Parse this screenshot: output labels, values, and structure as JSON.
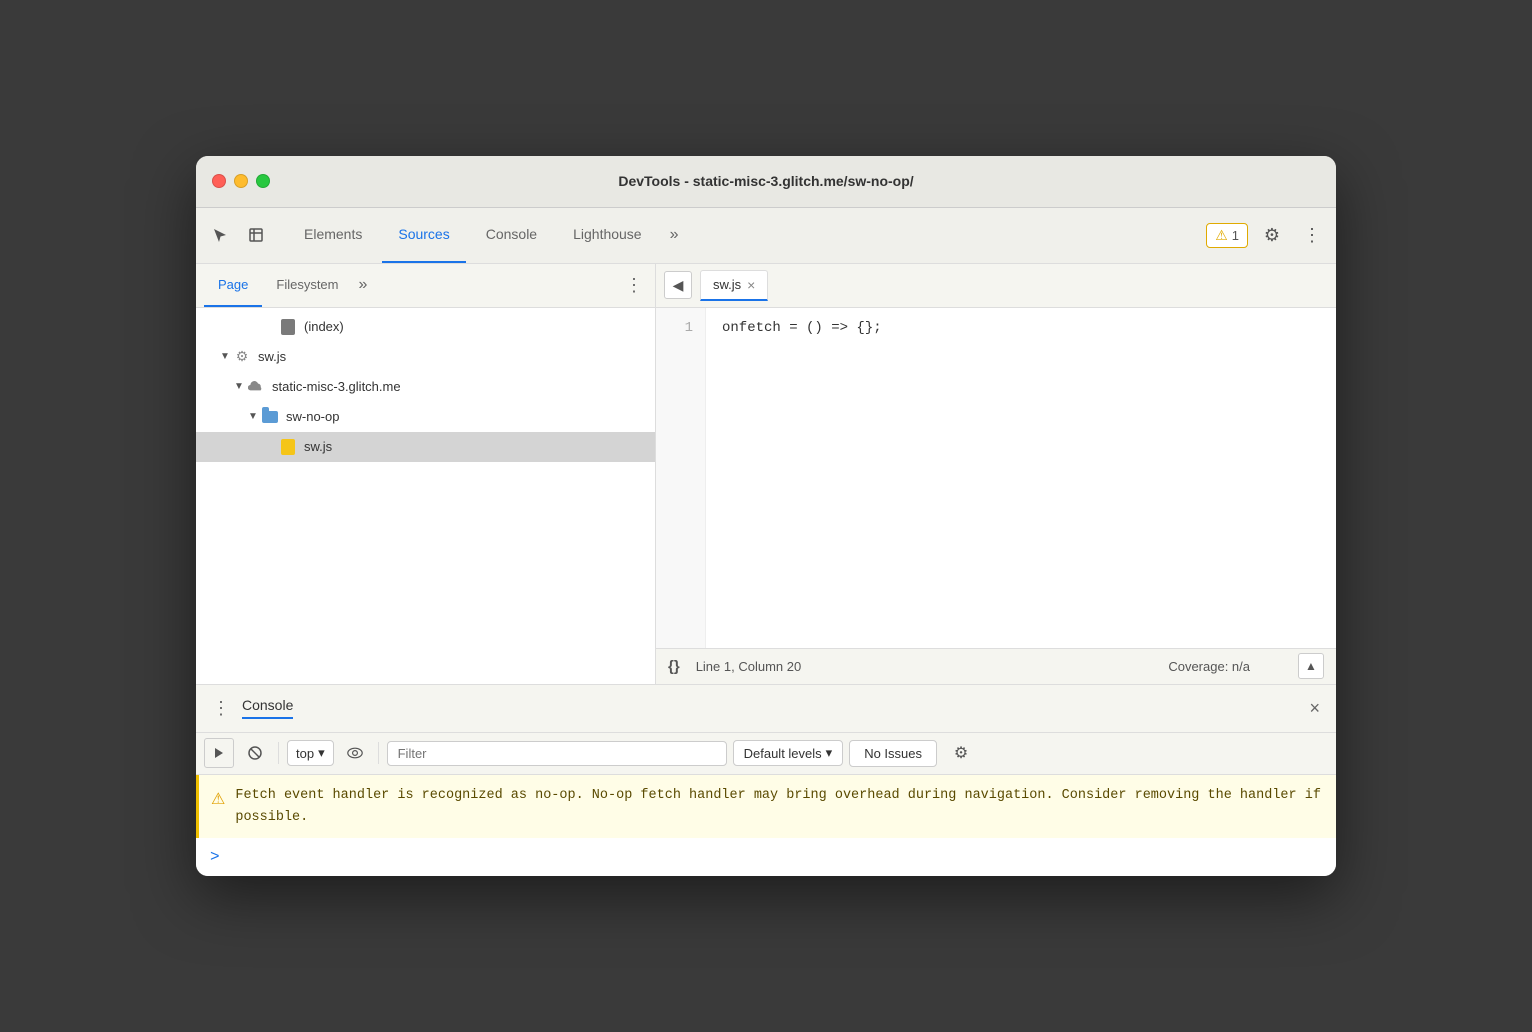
{
  "window": {
    "title": "DevTools - static-misc-3.glitch.me/sw-no-op/"
  },
  "tabbar": {
    "tabs": [
      {
        "label": "Elements",
        "active": false
      },
      {
        "label": "Sources",
        "active": true
      },
      {
        "label": "Console",
        "active": false
      },
      {
        "label": "Lighthouse",
        "active": false
      }
    ],
    "more_label": "»",
    "warning_count": "1",
    "settings_icon": "⚙",
    "menu_icon": "⋮"
  },
  "sources": {
    "sidebar_tabs": [
      {
        "label": "Page",
        "active": true
      },
      {
        "label": "Filesystem",
        "active": false
      }
    ],
    "sidebar_more": "»",
    "sidebar_menu": "⋮",
    "files": [
      {
        "indent": 3,
        "type": "file-doc",
        "name": "(index)",
        "arrow": "",
        "depth": 3
      },
      {
        "indent": 1,
        "type": "file-js-gear",
        "name": "sw.js",
        "arrow": "▼",
        "depth": 1
      },
      {
        "indent": 2,
        "type": "cloud",
        "name": "static-misc-3.glitch.me",
        "arrow": "▼",
        "depth": 2
      },
      {
        "indent": 3,
        "type": "folder",
        "name": "sw-no-op",
        "arrow": "▼",
        "depth": 3
      },
      {
        "indent": 4,
        "type": "file-js",
        "name": "sw.js",
        "arrow": "",
        "depth": 4,
        "selected": true
      }
    ]
  },
  "editor": {
    "sidebar_btn": "◀",
    "active_tab": "sw.js",
    "close_icon": "×",
    "line_numbers": [
      "1"
    ],
    "code": "onfetch = () => {};",
    "statusbar": {
      "braces": "{}",
      "position": "Line 1, Column 20",
      "coverage": "Coverage: n/a",
      "scroll_up": "▲"
    }
  },
  "console": {
    "menu_icon": "⋮",
    "title": "Console",
    "close_icon": "×",
    "toolbar": {
      "clear_btn": "🚫",
      "run_btn": "▶",
      "context_label": "top",
      "context_arrow": "▾",
      "eye_icon": "👁",
      "filter_placeholder": "Filter",
      "levels_label": "Default levels",
      "levels_arrow": "▾",
      "no_issues": "No Issues",
      "settings_icon": "⚙"
    },
    "warning_message": "Fetch event handler is recognized as no-op. No-op fetch handler may bring overhead during navigation. Consider removing the handler if possible.",
    "prompt_arrow": ">"
  }
}
